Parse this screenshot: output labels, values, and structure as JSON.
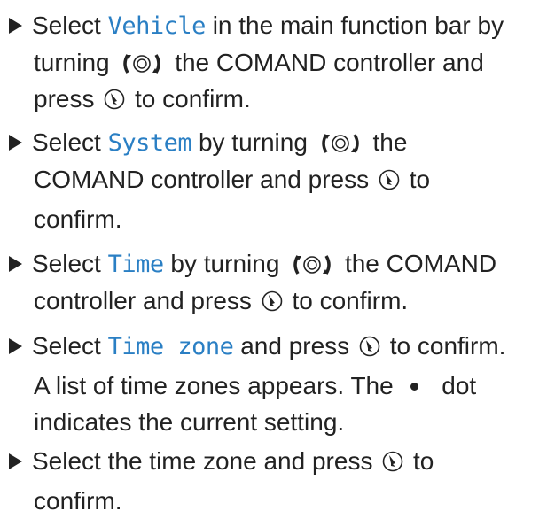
{
  "steps": [
    {
      "t_select": "Select",
      "kw": "Vehicle",
      "t_a": "in the main function bar by",
      "t_b": "turning",
      "t_c": "the COMAND controller and",
      "t_d": "press",
      "t_e": "to confirm."
    },
    {
      "t_select": "Select",
      "kw": "System",
      "t_a": "by turning",
      "t_b": "the",
      "t_c": "COMAND controller and press",
      "t_d": "to",
      "t_e": "confirm."
    },
    {
      "t_select": "Select",
      "kw": "Time",
      "t_a": "by turning",
      "t_b": "the COMAND",
      "t_c": "controller and press",
      "t_d": "to confirm."
    },
    {
      "t_select": "Select",
      "kw": "Time zone",
      "t_a": "and press",
      "t_b": "to confirm.",
      "t_c": "A list of time zones appears. The",
      "t_d": "dot",
      "t_e": "indicates the current setting."
    },
    {
      "t_a": "Select the time zone and press",
      "t_b": "to",
      "t_c": "confirm."
    }
  ],
  "icons": {
    "rotate": "controller-turn-icon",
    "press": "controller-press-icon",
    "dot": "bullet-dot-icon"
  },
  "colors": {
    "keyword": "#2a7fc4",
    "text": "#222222"
  }
}
